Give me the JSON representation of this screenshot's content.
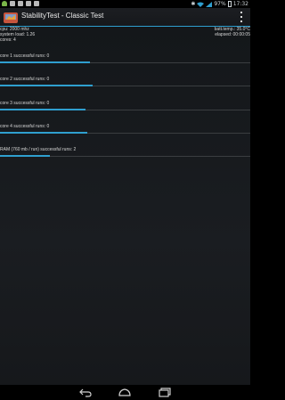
{
  "status_bar": {
    "battery_percent": "97%",
    "clock": "17:32",
    "icons": [
      "android-icon",
      "image-icon",
      "image-icon",
      "image-icon",
      "notification-icon"
    ]
  },
  "action_bar": {
    "title": "StabilityTest - Classic Test",
    "accent": "#2f9fcf"
  },
  "info": {
    "cpu": "cpu: 2000 mhz",
    "system_load": "system load: 1.26",
    "cores": "cores: 4",
    "batt_temp": "batt.temp.: 35.0°C",
    "elapsed": "elapsed: 00:00:05"
  },
  "rows": [
    {
      "label": "core 1 successful runs: 0",
      "progress": 0.36
    },
    {
      "label": "core 2 successful runs: 0",
      "progress": 0.37
    },
    {
      "label": "core 3 successful runs: 0",
      "progress": 0.34
    },
    {
      "label": "core 4 successful runs: 0",
      "progress": 0.35
    },
    {
      "label": "RAM (760 mb / run) successful runs: 2",
      "progress": 0.2
    }
  ]
}
